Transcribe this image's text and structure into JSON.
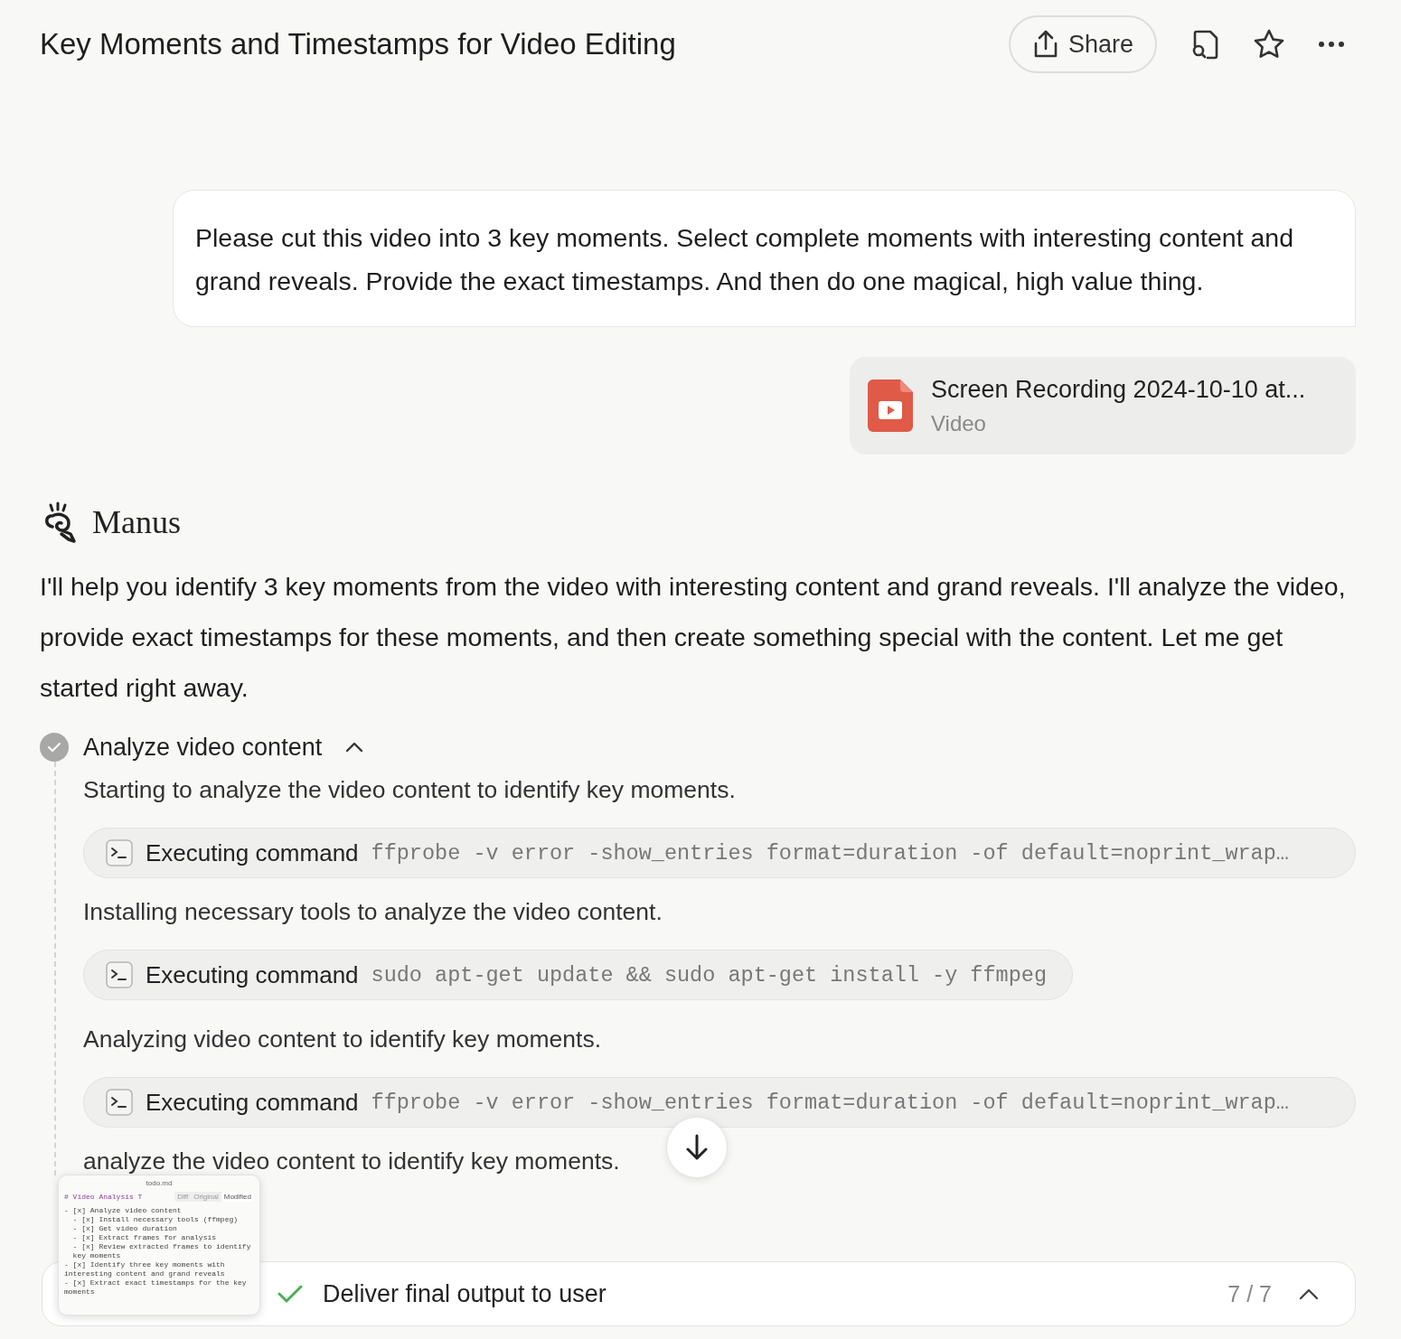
{
  "header": {
    "title": "Key Moments and Timestamps for Video Editing",
    "share_label": "Share"
  },
  "user_message": {
    "text": "Please cut this video into 3 key moments. Select complete moments with interesting content and grand reveals. Provide the exact timestamps. And then do one magical, high value thing."
  },
  "attachment": {
    "name": "Screen Recording 2024-10-10 at...",
    "type": "Video"
  },
  "assistant": {
    "name": "Manus",
    "text": "I'll help you identify 3 key moments from the video with interesting content and grand reveals. I'll analyze the video, provide exact timestamps for these moments, and then create something special with the content. Let me get started right away."
  },
  "task": {
    "title": "Analyze video content",
    "done": true,
    "expanded": true,
    "steps": [
      {
        "kind": "text",
        "text": "Starting to analyze the video content to identify key moments."
      },
      {
        "kind": "command",
        "label": "Executing command",
        "command": "ffprobe -v error -show_entries format=duration -of default=noprint_wrap…",
        "full": true
      },
      {
        "kind": "text",
        "text": "Installing necessary tools to analyze the video content."
      },
      {
        "kind": "command",
        "label": "Executing command",
        "command": "sudo apt-get update && sudo apt-get install -y ffmpeg",
        "full": false
      },
      {
        "kind": "text",
        "text": "Analyzing video content to identify key moments."
      },
      {
        "kind": "command",
        "label": "Executing command",
        "command": "ffprobe -v error -show_entries format=duration -of default=noprint_wrap…",
        "full": true
      },
      {
        "kind": "text",
        "text": "analyze the video content to identify key moments."
      }
    ]
  },
  "preview": {
    "filename": "todo.md",
    "heading": "# Video Analysis T",
    "tabs": [
      {
        "label": "Diff",
        "selected": false
      },
      {
        "label": "Original",
        "selected": false
      },
      {
        "label": "Modified",
        "selected": true
      }
    ],
    "lines": [
      "- [x] Analyze video content",
      "  - [x] Install necessary tools (ffmpeg)",
      "  - [x] Get video duration",
      "  - [x] Extract frames for analysis",
      "  - [x] Review extracted frames to identify",
      "  key moments",
      "- [x] Identify three key moments with",
      "interesting content and grand reveals",
      "- [x] Extract exact timestamps for the key",
      "moments"
    ]
  },
  "progress_bar": {
    "current_step": "Deliver final output to user",
    "done": true,
    "count": "7 / 7"
  }
}
